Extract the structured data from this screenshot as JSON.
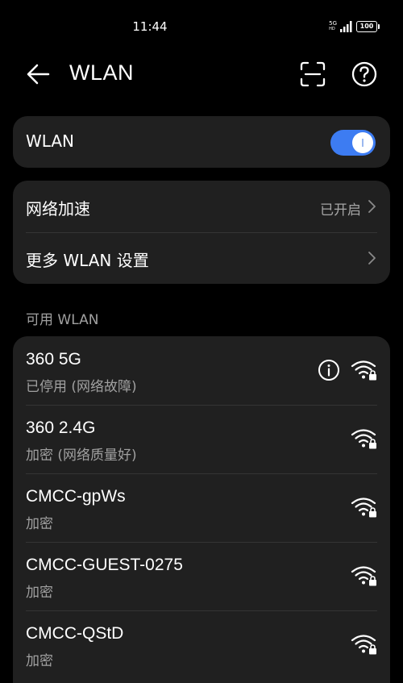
{
  "status_bar": {
    "time": "11:44",
    "network_type": "5G",
    "network_sub": "HD",
    "battery": "100"
  },
  "header": {
    "title": "WLAN"
  },
  "wlan_toggle": {
    "label": "WLAN",
    "enabled": true
  },
  "settings": {
    "acceleration_label": "网络加速",
    "acceleration_value": "已开启",
    "more_settings_label": "更多 WLAN 设置"
  },
  "available": {
    "section_title": "可用 WLAN",
    "networks": [
      {
        "name": "360 5G",
        "status": "已停用 (网络故障)",
        "has_info": true,
        "secured": true
      },
      {
        "name": "360 2.4G",
        "status": "加密 (网络质量好)",
        "has_info": false,
        "secured": true
      },
      {
        "name": "CMCC-gpWs",
        "status": "加密",
        "has_info": false,
        "secured": true
      },
      {
        "name": "CMCC-GUEST-0275",
        "status": "加密",
        "has_info": false,
        "secured": true
      },
      {
        "name": "CMCC-QStD",
        "status": "加密",
        "has_info": false,
        "secured": true
      }
    ]
  },
  "colors": {
    "background": "#000000",
    "card": "#202020",
    "accent": "#3d7cf2",
    "secondary_text": "#a0a0a0"
  }
}
